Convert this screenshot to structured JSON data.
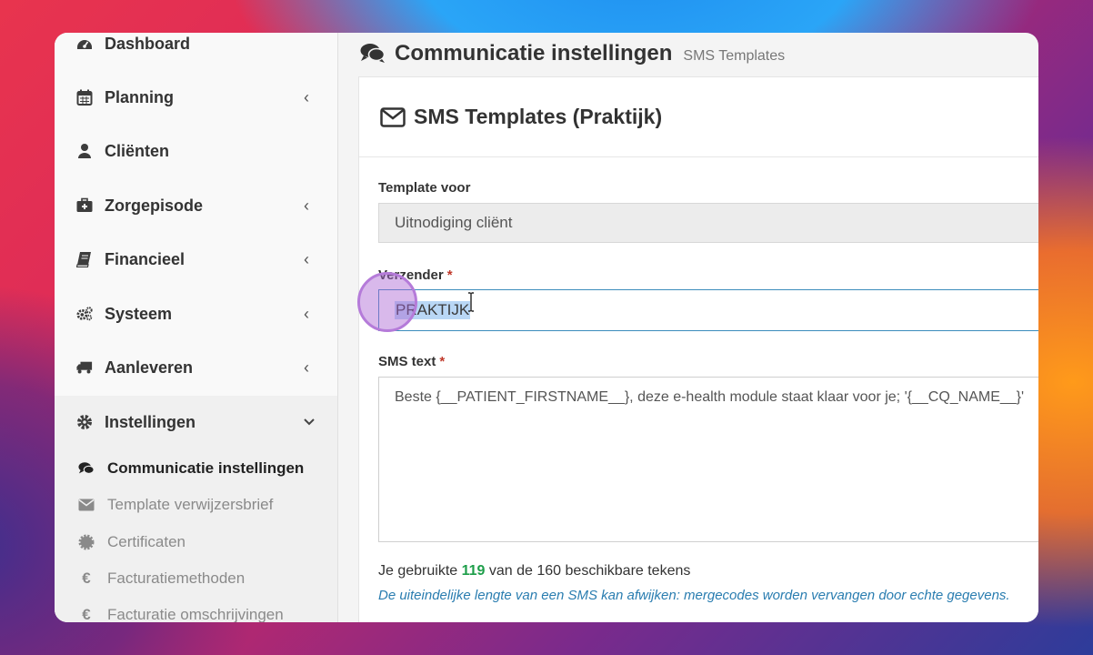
{
  "sidebar": {
    "items": [
      {
        "label": "Dashboard",
        "icon": "dashboard-icon",
        "has_chevron": false
      },
      {
        "label": "Planning",
        "icon": "calendar-icon",
        "has_chevron": true
      },
      {
        "label": "Cliënten",
        "icon": "user-icon",
        "has_chevron": false
      },
      {
        "label": "Zorgepisode",
        "icon": "medkit-icon",
        "has_chevron": true
      },
      {
        "label": "Financieel",
        "icon": "book-icon",
        "has_chevron": true
      },
      {
        "label": "Systeem",
        "icon": "cogs-icon",
        "has_chevron": true
      },
      {
        "label": "Aanleveren",
        "icon": "truck-icon",
        "has_chevron": true
      },
      {
        "label": "Instellingen",
        "icon": "gear-icon",
        "has_chevron": true,
        "expanded": true
      }
    ],
    "chevron_closed": "‹",
    "chevron_open": "⌄",
    "subitems": [
      {
        "label": "Communicatie instellingen",
        "icon": "comments-icon",
        "active": true
      },
      {
        "label": "Template verwijzersbrief",
        "icon": "envelope-icon",
        "active": false
      },
      {
        "label": "Certificaten",
        "icon": "certificate-icon",
        "active": false
      },
      {
        "label": "Facturatiemethoden",
        "icon": "euro-icon",
        "glyph": "€",
        "active": false
      },
      {
        "label": "Facturatie omschrijvingen",
        "icon": "euro-icon",
        "glyph": "€",
        "active": false
      }
    ]
  },
  "header": {
    "title": "Communicatie instellingen",
    "subtitle": "SMS Templates"
  },
  "card": {
    "title": "SMS Templates (Praktijk)"
  },
  "form": {
    "template_label": "Template voor",
    "template_value": "Uitnodiging cliënt",
    "sender_label": "Verzender",
    "sender_value": "PRAKTIJK",
    "sms_label": "SMS text",
    "sms_value": "Beste {__PATIENT_FIRSTNAME__}, deze e-health module staat klaar voor je; '{__CQ_NAME__}'",
    "required_mark": "*"
  },
  "counter": {
    "prefix": "Je gebruikte",
    "used": "119",
    "suffix": "van de 160 beschikbare tekens"
  },
  "hint": "De uiteindelijke lengte van een SMS kan afwijken: mergecodes worden vervangen door echte gegevens.",
  "colors": {
    "accent_border": "#3c8dbc",
    "counter_green": "#1e9e4a",
    "hint_blue": "#2a7db0",
    "required_red": "#c0392b",
    "selection": "#b9d7f5"
  }
}
